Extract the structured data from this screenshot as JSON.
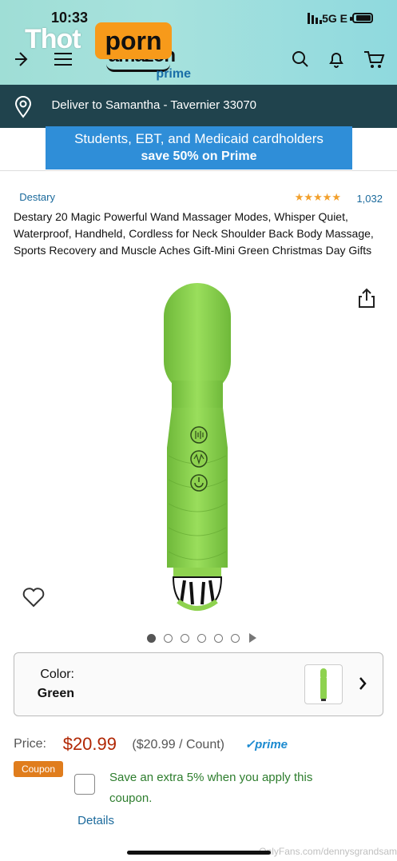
{
  "status": {
    "time": "10:33",
    "network": "5G E"
  },
  "nav": {
    "logo_main": "amazon",
    "logo_sub": "prime",
    "watermark_left": "Thot",
    "watermark_right": "porn"
  },
  "delivery": {
    "text": "Deliver to Samantha - Tavernier 33070"
  },
  "promo": {
    "line1": "Students, EBT, and Medicaid cardholders",
    "line2": "save 50% on Prime",
    "color": "#2f8ed8"
  },
  "product": {
    "brand": "Destary",
    "stars": "★★★★★",
    "rating_count": "1,032",
    "title": "Destary 20 Magic Powerful Wand Massager Modes, Whisper Quiet, Waterproof, Handheld, Cordless for Neck Shoulder Back Body Massage, Sports Recovery and Muscle Aches Gift-Mini Green Christmas Day Gifts",
    "product_color": "#8ed24f"
  },
  "carousel": {
    "dot_count": 6,
    "active_index": 0
  },
  "color_selector": {
    "label": "Color:",
    "value": "Green"
  },
  "pricing": {
    "label": "Price:",
    "value": "$20.99",
    "unit": "($20.99 / Count)",
    "prime": "✓prime"
  },
  "coupon": {
    "badge": "Coupon",
    "text": "Save an extra 5% when you apply this coupon."
  },
  "details_link": "Details",
  "footer_watermark": "OnlyFans.com/dennysgrandsam",
  "icons": {
    "back": "back-arrow-icon",
    "menu": "menu-icon",
    "search": "search-icon",
    "bell": "bell-icon",
    "cart": "cart-icon",
    "pin": "location-pin-icon",
    "share": "share-icon",
    "heart": "heart-icon",
    "chevron": "chevron-right-icon"
  }
}
